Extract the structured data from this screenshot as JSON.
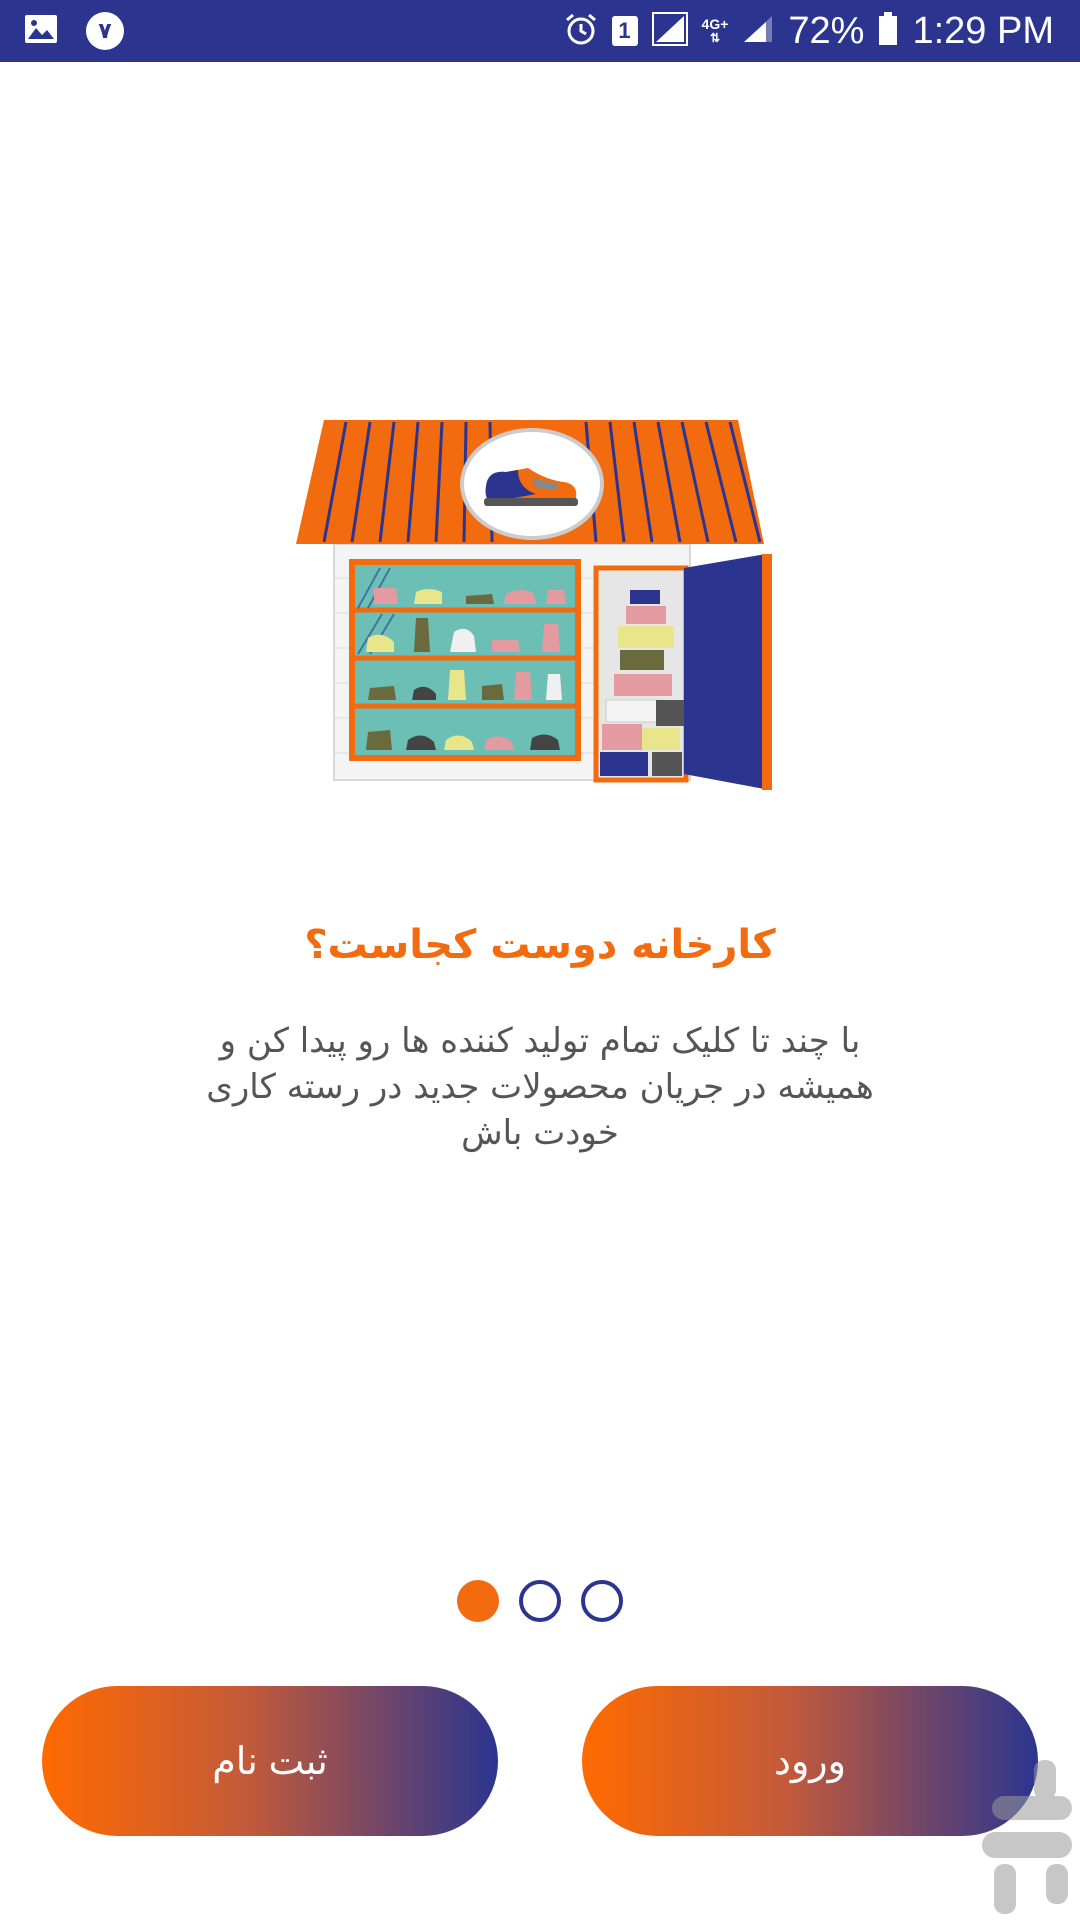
{
  "status_bar": {
    "notification_badge": "۷",
    "sim_slot": "1",
    "network_type": "4G+",
    "battery": "72%",
    "time": "1:29 PM",
    "icons": [
      "gallery-icon",
      "alarm-icon",
      "sim-icon",
      "signal-icon",
      "battery-icon"
    ]
  },
  "onboarding": {
    "title": "کارخانه دوست کجاست؟",
    "description": "با چند تا کلیک تمام تولید کننده ها رو پیدا کن و همیشه در جریان محصولات جدید در رسته کاری خودت باش",
    "current_page": 1,
    "total_pages": 3
  },
  "buttons": {
    "register": "ثبت نام",
    "login": "ورود"
  },
  "colors": {
    "accent": "#F26B0F",
    "brand_blue": "#2B3590",
    "status_bar": "#2B3590"
  }
}
